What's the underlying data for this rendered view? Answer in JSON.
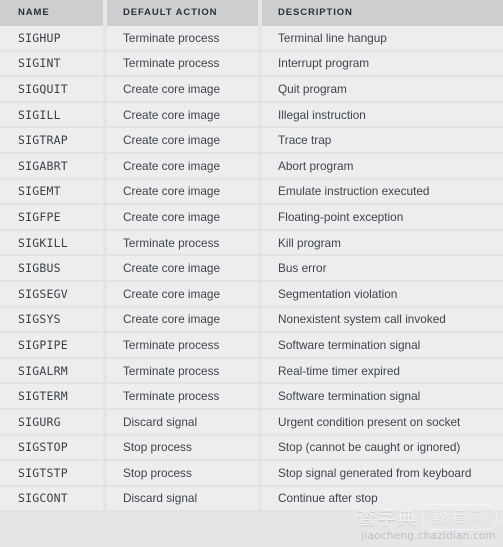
{
  "table": {
    "columns": [
      {
        "key": "name",
        "label": "NAME"
      },
      {
        "key": "action",
        "label": "DEFAULT ACTION"
      },
      {
        "key": "desc",
        "label": "DESCRIPTION"
      }
    ],
    "rows": [
      {
        "name": "SIGHUP",
        "action": "Terminate process",
        "desc": "Terminal line hangup"
      },
      {
        "name": "SIGINT",
        "action": "Terminate process",
        "desc": "Interrupt program"
      },
      {
        "name": "SIGQUIT",
        "action": "Create core image",
        "desc": "Quit program"
      },
      {
        "name": "SIGILL",
        "action": "Create core image",
        "desc": "Illegal instruction"
      },
      {
        "name": "SIGTRAP",
        "action": "Create core image",
        "desc": "Trace trap"
      },
      {
        "name": "SIGABRT",
        "action": "Create core image",
        "desc": "Abort program"
      },
      {
        "name": "SIGEMT",
        "action": "Create core image",
        "desc": "Emulate instruction executed"
      },
      {
        "name": "SIGFPE",
        "action": "Create core image",
        "desc": "Floating-point exception"
      },
      {
        "name": "SIGKILL",
        "action": "Terminate process",
        "desc": "Kill program"
      },
      {
        "name": "SIGBUS",
        "action": "Create core image",
        "desc": "Bus error"
      },
      {
        "name": "SIGSEGV",
        "action": "Create core image",
        "desc": "Segmentation violation"
      },
      {
        "name": "SIGSYS",
        "action": "Create core image",
        "desc": "Nonexistent system call invoked"
      },
      {
        "name": "SIGPIPE",
        "action": "Terminate process",
        "desc": "Software termination signal"
      },
      {
        "name": "SIGALRM",
        "action": "Terminate process",
        "desc": "Real-time timer expired"
      },
      {
        "name": "SIGTERM",
        "action": "Terminate process",
        "desc": "Software termination signal"
      },
      {
        "name": "SIGURG",
        "action": "Discard signal",
        "desc": "Urgent condition present on socket"
      },
      {
        "name": "SIGSTOP",
        "action": "Stop process",
        "desc": "Stop (cannot be caught or ignored)"
      },
      {
        "name": "SIGTSTP",
        "action": "Stop process",
        "desc": "Stop signal generated from keyboard"
      },
      {
        "name": "SIGCONT",
        "action": "Discard signal",
        "desc": "Continue after stop"
      }
    ]
  },
  "watermark": {
    "text_left": "查字典",
    "text_right": "教程网",
    "url": "jiaocheng.chazidian.com"
  },
  "colors": {
    "header_bg": "#ccced0",
    "row_bg": "#ededed",
    "page_bg": "#e4e6e8",
    "row_separator": "#e0e2e5",
    "header_text": "#2b3038",
    "body_text": "#3d4450",
    "name_text": "#3a4048"
  }
}
